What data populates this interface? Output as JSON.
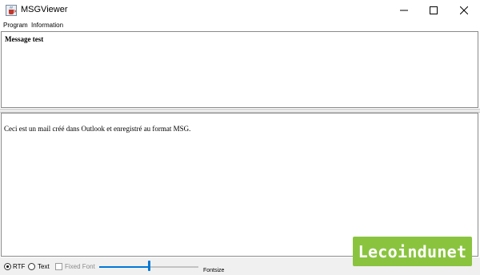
{
  "window": {
    "title": "MSGViewer",
    "icon": "java-cup-icon"
  },
  "menubar": {
    "items": [
      {
        "label": "Program"
      },
      {
        "label": "Information"
      }
    ]
  },
  "message": {
    "subject": "Message test",
    "body": "Ceci est un mail créé dans Outlook et enregistré au format MSG."
  },
  "statusbar": {
    "rtf_label": "RTF",
    "text_label": "Text",
    "fixed_font_label": "Fixed Font",
    "fontsize_label": "Fontsize",
    "selected_mode": "RTF",
    "fixed_font_checked": false,
    "fontsize_level": 0.5
  },
  "watermark": {
    "text": "Lecoindunet",
    "color": "#8ac43f"
  }
}
